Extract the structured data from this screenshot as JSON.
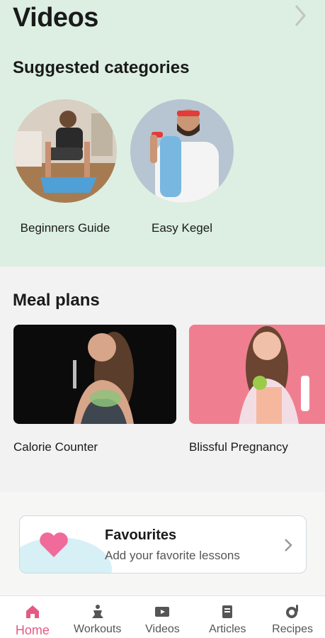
{
  "header": {
    "title": "Videos"
  },
  "suggested": {
    "title": "Suggested categories",
    "items": [
      {
        "label": "Beginners Guide"
      },
      {
        "label": "Easy Kegel"
      }
    ]
  },
  "meals": {
    "title": "Meal plans",
    "items": [
      {
        "label": "Calorie Counter"
      },
      {
        "label": "Blissful Pregnancy"
      }
    ]
  },
  "favourites": {
    "title": "Favourites",
    "subtitle": "Add your favorite lessons"
  },
  "nav": {
    "items": [
      {
        "label": "Home",
        "icon": "home-icon"
      },
      {
        "label": "Workouts",
        "icon": "workouts-icon"
      },
      {
        "label": "Videos",
        "icon": "videos-icon"
      },
      {
        "label": "Articles",
        "icon": "articles-icon"
      },
      {
        "label": "Recipes",
        "icon": "recipes-icon"
      }
    ],
    "active": "Home"
  },
  "colors": {
    "accent": "#e45a84",
    "green_bg": "#dcefe2"
  }
}
